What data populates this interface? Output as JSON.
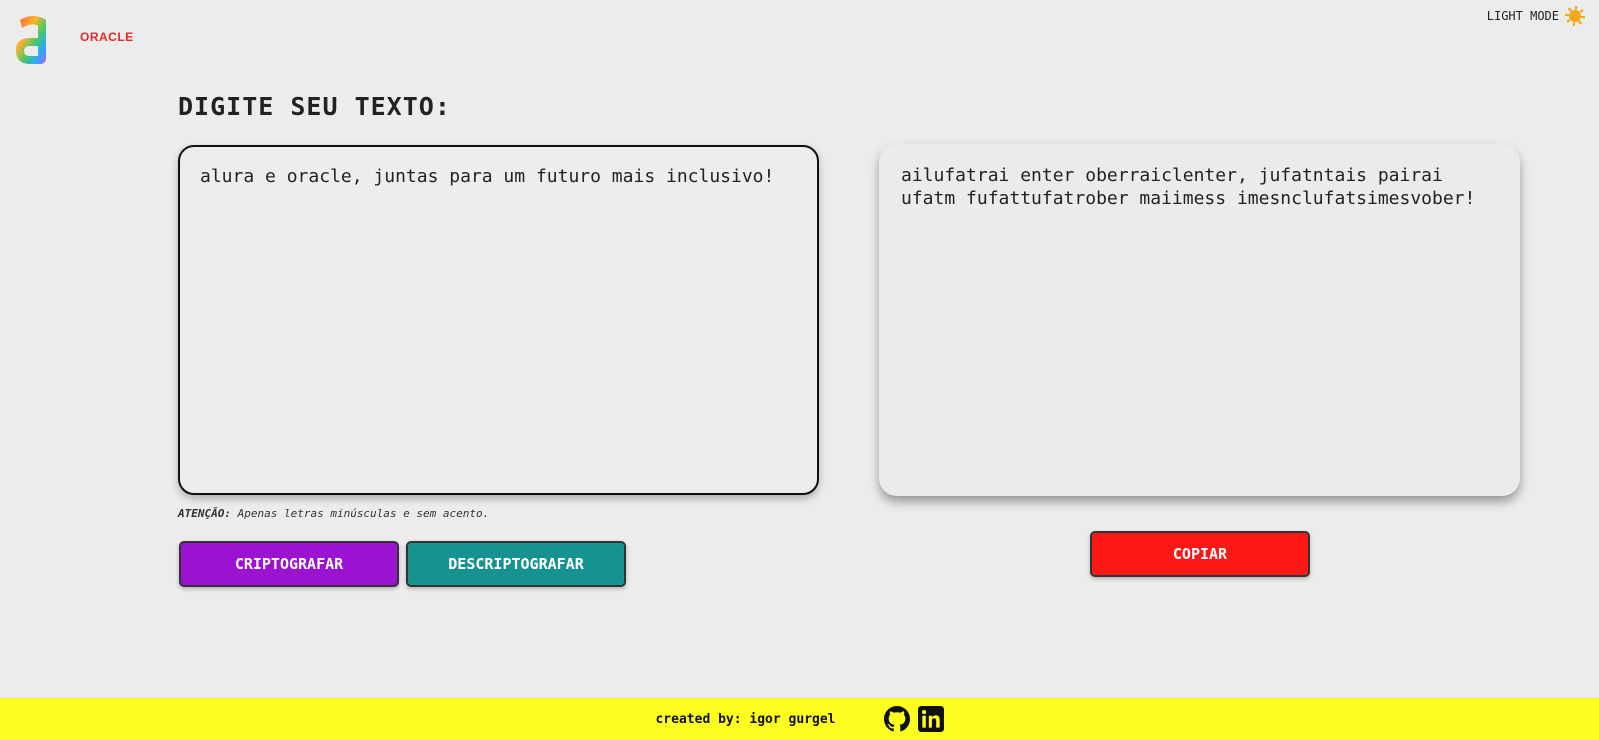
{
  "header": {
    "brand_left": "alura",
    "brand_right": "ORACLE",
    "theme_toggle": "LIGHT MODE",
    "theme_icon": "sun-icon"
  },
  "main": {
    "heading": "DIGITE SEU TEXTO:",
    "input_value": "alura e oracle, juntas para um futuro mais inclusivo!",
    "hint_label": "ATENÇÃO:",
    "hint_text": " Apenas letras minúsculas e sem acento.",
    "encrypt_label": "CRIPTOGRAFAR",
    "decrypt_label": "DESCRIPTOGRAFAR",
    "output_value": "ailufatrai enter oberraiclenter, jufatntais pairai ufatm fufattufatrober maiimess imesnclufatsimesvober!",
    "copy_label": "COPIAR"
  },
  "footer": {
    "credit": "created by: igor gurgel",
    "icons": [
      "github-icon",
      "linkedin-icon"
    ]
  },
  "colors": {
    "background": "#ececec",
    "encrypt_button": "#9b12d0",
    "decrypt_button": "#169391",
    "copy_button": "#fd1717",
    "footer": "#fdfd20",
    "oracle_red": "#e4292b"
  }
}
